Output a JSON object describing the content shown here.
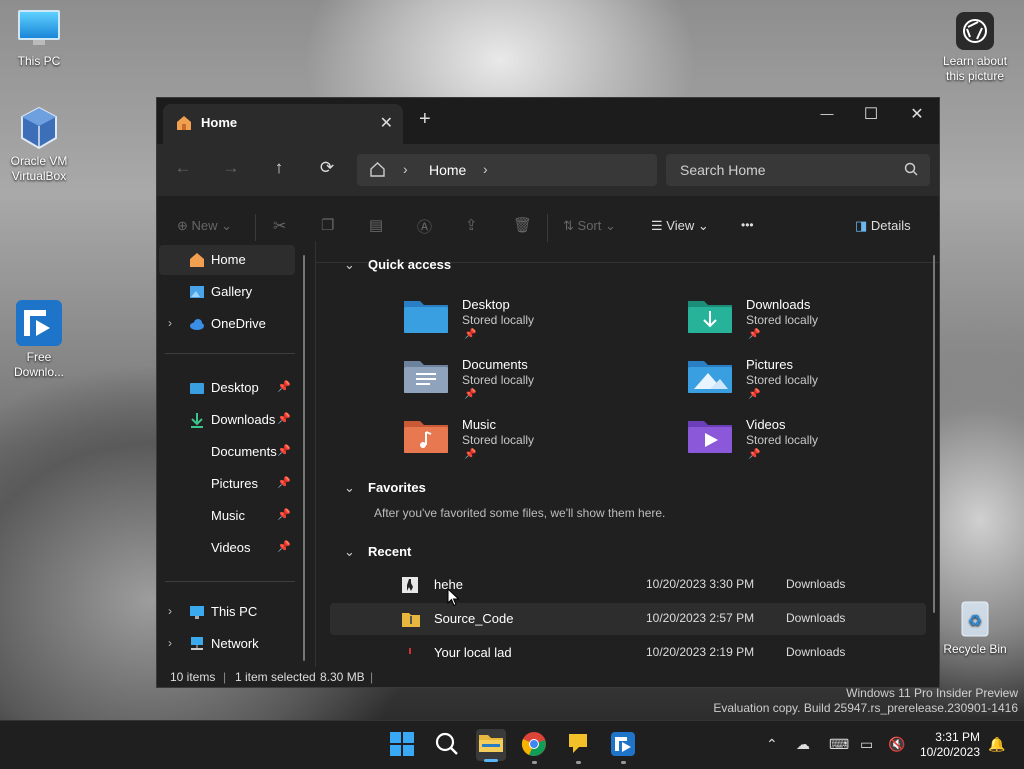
{
  "desktop": {
    "icons": [
      {
        "label": "This PC",
        "icon": "monitor-icon"
      },
      {
        "label": "Oracle VM VirtualBox",
        "icon": "virtualbox-icon"
      },
      {
        "label": "Free Downlo...",
        "icon": "free-download-manager-icon"
      },
      {
        "label": "Recycle Bin",
        "icon": "recycle-bin-icon"
      }
    ],
    "learn_label": "Learn about this picture",
    "watermark_line1": "Windows 11 Pro Insider Preview",
    "watermark_line2": "Evaluation copy. Build 25947.rs_prerelease.230901-1416"
  },
  "window": {
    "tab_title": "Home",
    "close_tab": "✕",
    "new_tab": "+",
    "minimize": "—",
    "maximize": "☐",
    "close": "✕"
  },
  "navbar": {
    "breadcrumb": "Home",
    "search_placeholder": "Search Home"
  },
  "commandbar": {
    "new_label": "New",
    "sort_label": "Sort",
    "view_label": "View",
    "more_label": "•••",
    "details_label": "Details"
  },
  "sidebar": {
    "items": [
      {
        "label": "Home",
        "icon": "home-icon",
        "selected": true
      },
      {
        "label": "Gallery",
        "icon": "gallery-icon"
      },
      {
        "label": "OneDrive",
        "icon": "cloud-icon",
        "expandable": true
      },
      {
        "label": "Desktop",
        "icon": "desktop-folder-icon",
        "pinned": true
      },
      {
        "label": "Downloads",
        "icon": "download-icon",
        "pinned": true
      },
      {
        "label": "Documents",
        "icon": "documents-folder-icon",
        "pinned": true
      },
      {
        "label": "Pictures",
        "icon": "pictures-folder-icon",
        "pinned": true
      },
      {
        "label": "Music",
        "icon": "music-folder-icon",
        "pinned": true
      },
      {
        "label": "Videos",
        "icon": "videos-folder-icon",
        "pinned": true
      },
      {
        "label": "This PC",
        "icon": "monitor-icon",
        "expandable": true
      },
      {
        "label": "Network",
        "icon": "network-icon",
        "expandable": true
      }
    ]
  },
  "quick_access": {
    "title": "Quick access",
    "items": [
      {
        "name": "Desktop",
        "sub": "Stored locally",
        "color": "#3a9fe0"
      },
      {
        "name": "Downloads",
        "sub": "Stored locally",
        "color": "#26b39a"
      },
      {
        "name": "Documents",
        "sub": "Stored locally",
        "color": "#8fa3bd"
      },
      {
        "name": "Pictures",
        "sub": "Stored locally",
        "color": "#3a9fe0"
      },
      {
        "name": "Music",
        "sub": "Stored locally",
        "color": "#e8784f"
      },
      {
        "name": "Videos",
        "sub": "Stored locally",
        "color": "#8a58d8"
      }
    ]
  },
  "favorites": {
    "title": "Favorites",
    "empty_text": "After you've favorited some files, we'll show them here."
  },
  "recent": {
    "title": "Recent",
    "items": [
      {
        "name": "hehe",
        "date": "10/20/2023 3:30 PM",
        "location": "Downloads"
      },
      {
        "name": "Source_Code",
        "date": "10/20/2023 2:57 PM",
        "location": "Downloads"
      },
      {
        "name": "Your local lad",
        "date": "10/20/2023 2:19 PM",
        "location": "Downloads"
      }
    ]
  },
  "statusbar": {
    "count": "10 items",
    "selection": "1 item selected",
    "size": "8.30 MB"
  },
  "taskbar": {
    "time": "3:31 PM",
    "date": "10/20/2023"
  }
}
